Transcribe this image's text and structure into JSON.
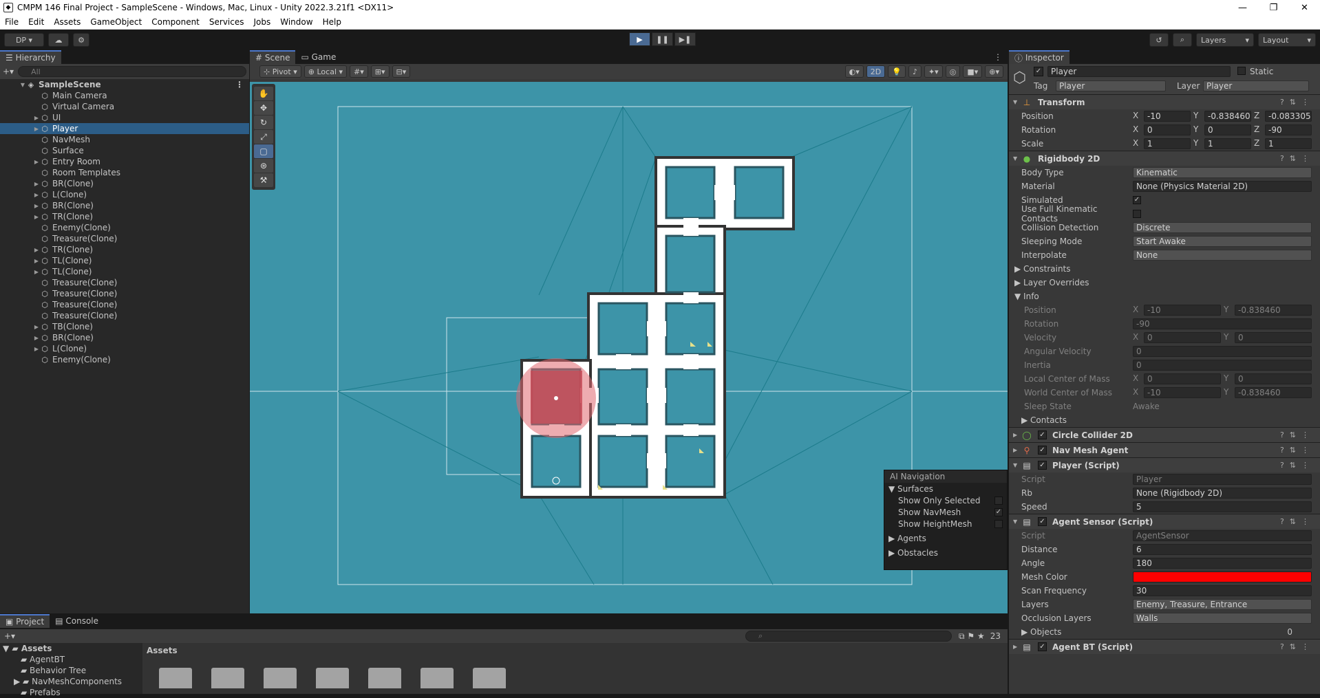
{
  "window": {
    "title": "CMPM 146 Final Project - SampleScene - Windows, Mac, Linux - Unity 2022.3.21f1 <DX11>",
    "controls": [
      "—",
      "❐",
      "✕"
    ]
  },
  "menu": [
    "File",
    "Edit",
    "Assets",
    "GameObject",
    "Component",
    "Services",
    "Jobs",
    "Window",
    "Help"
  ],
  "toolbar": {
    "account": "DP ▾",
    "layers": "Layers",
    "layout": "Layout"
  },
  "hierarchy": {
    "tab": "Hierarchy",
    "search_placeholder": "All",
    "scene": "SampleScene",
    "items": [
      {
        "name": "Main Camera",
        "arrow": ""
      },
      {
        "name": "Virtual Camera",
        "arrow": ""
      },
      {
        "name": "UI",
        "arrow": "▶"
      },
      {
        "name": "Player",
        "arrow": "▶",
        "selected": true
      },
      {
        "name": "NavMesh",
        "arrow": ""
      },
      {
        "name": "Surface",
        "arrow": ""
      },
      {
        "name": "Entry Room",
        "arrow": "▶"
      },
      {
        "name": "Room Templates",
        "arrow": ""
      },
      {
        "name": "BR(Clone)",
        "arrow": "▶"
      },
      {
        "name": "L(Clone)",
        "arrow": "▶"
      },
      {
        "name": "BR(Clone)",
        "arrow": "▶"
      },
      {
        "name": "TR(Clone)",
        "arrow": "▶"
      },
      {
        "name": "Enemy(Clone)",
        "arrow": ""
      },
      {
        "name": "Treasure(Clone)",
        "arrow": ""
      },
      {
        "name": "TR(Clone)",
        "arrow": "▶"
      },
      {
        "name": "TL(Clone)",
        "arrow": "▶"
      },
      {
        "name": "TL(Clone)",
        "arrow": "▶"
      },
      {
        "name": "Treasure(Clone)",
        "arrow": ""
      },
      {
        "name": "Treasure(Clone)",
        "arrow": ""
      },
      {
        "name": "Treasure(Clone)",
        "arrow": ""
      },
      {
        "name": "Treasure(Clone)",
        "arrow": ""
      },
      {
        "name": "TB(Clone)",
        "arrow": "▶"
      },
      {
        "name": "BR(Clone)",
        "arrow": "▶"
      },
      {
        "name": "L(Clone)",
        "arrow": "▶"
      },
      {
        "name": "Enemy(Clone)",
        "arrow": ""
      }
    ]
  },
  "scene": {
    "tabs": [
      "Scene",
      "Game"
    ],
    "pivot": "Pivot",
    "local": "Local",
    "mode2d": "2D",
    "overlay": {
      "title": "AI Navigation",
      "surfaces": "Surfaces",
      "show_only_selected": "Show Only Selected",
      "show_navmesh": "Show NavMesh",
      "show_heightmesh": "Show HeightMesh",
      "agents": "Agents",
      "obstacles": "Obstacles"
    }
  },
  "inspector": {
    "tab": "Inspector",
    "object_name": "Player",
    "static": "Static",
    "tag_label": "Tag",
    "tag": "Player",
    "layer_label": "Layer",
    "layer": "Player",
    "transform": {
      "title": "Transform",
      "position": [
        "-10",
        "-0.838460",
        "-0.083305"
      ],
      "rotation": [
        "0",
        "0",
        "-90"
      ],
      "scale": [
        "1",
        "1",
        "1"
      ]
    },
    "rigidbody": {
      "title": "Rigidbody 2D",
      "body_type": "Kinematic",
      "material": "None (Physics Material 2D)",
      "simulated_label": "Simulated",
      "full_kinematic": "Use Full Kinematic Contacts",
      "collision": "Discrete",
      "sleeping": "Start Awake",
      "interpolate": "None",
      "constraints": "Constraints",
      "layer_overrides": "Layer Overrides",
      "info": "Info",
      "info_position": [
        "-10",
        "-0.838460"
      ],
      "info_rotation": "-90",
      "velocity": [
        "0",
        "0"
      ],
      "angular_velocity": "0",
      "inertia": "0",
      "local_com": [
        "0",
        "0"
      ],
      "world_com": [
        "-10",
        "-0.838460"
      ],
      "sleep_state": "Awake",
      "contacts": "Contacts"
    },
    "circle_collider": "Circle Collider 2D",
    "nav_mesh_agent": "Nav Mesh Agent",
    "player_script": {
      "title": "Player (Script)",
      "script": "Player",
      "rb": "None (Rigidbody 2D)",
      "speed": "5"
    },
    "agent_sensor": {
      "title": "Agent Sensor (Script)",
      "script": "AgentSensor",
      "distance": "6",
      "angle": "180",
      "mesh_color": "#ff0000",
      "scan_frequency": "30",
      "layers": "Enemy, Treasure, Entrance",
      "occlusion_layers": "Walls",
      "objects": "Objects",
      "objects_count": "0"
    },
    "agent_bt": "Agent BT (Script)"
  },
  "project": {
    "tabs": [
      "Project",
      "Console"
    ],
    "count": "23",
    "assets_title": "Assets",
    "tree": [
      "Assets",
      "AgentBT",
      "Behavior Tree",
      "NavMeshComponents",
      "Prefabs"
    ]
  },
  "labels": {
    "position": "Position",
    "rotation": "Rotation",
    "scale": "Scale",
    "body_type": "Body Type",
    "material": "Material",
    "collision": "Collision Detection",
    "sleeping": "Sleeping Mode",
    "interpolate": "Interpolate",
    "velocity": "Velocity",
    "angular_velocity": "Angular Velocity",
    "inertia": "Inertia",
    "local_com": "Local Center of Mass",
    "world_com": "World Center of Mass",
    "sleep_state": "Sleep State",
    "script": "Script",
    "rb": "Rb",
    "speed": "Speed",
    "distance": "Distance",
    "angle": "Angle",
    "mesh_color": "Mesh Color",
    "scan_frequency": "Scan Frequency",
    "layers": "Layers",
    "occlusion_layers": "Occlusion Layers"
  }
}
